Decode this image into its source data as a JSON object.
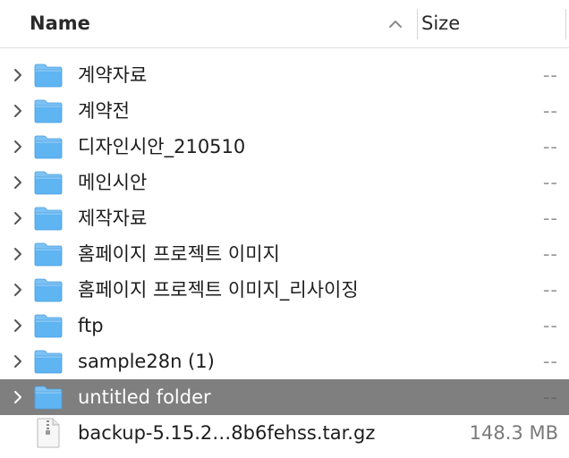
{
  "header": {
    "name_label": "Name",
    "size_label": "Size",
    "sort_icon": "chevron-up-icon"
  },
  "rows": [
    {
      "name": "계약자료",
      "size": "--",
      "kind": "folder"
    },
    {
      "name": "계약전",
      "size": "--",
      "kind": "folder"
    },
    {
      "name": "디자인시안_210510",
      "size": "--",
      "kind": "folder"
    },
    {
      "name": "메인시안",
      "size": "--",
      "kind": "folder"
    },
    {
      "name": "제작자료",
      "size": "--",
      "kind": "folder"
    },
    {
      "name": "홈페이지 프로젝트 이미지",
      "size": "--",
      "kind": "folder"
    },
    {
      "name": "홈페이지 프로젝트 이미지_리사이징",
      "size": "--",
      "kind": "folder"
    },
    {
      "name": "ftp",
      "size": "--",
      "kind": "folder"
    },
    {
      "name": "sample28n (1)",
      "size": "--",
      "kind": "folder"
    },
    {
      "name": "untitled folder",
      "size": "--",
      "kind": "folder",
      "selected": true
    },
    {
      "name": "backup-5.15.2…8b6fehss.tar.gz",
      "size": "148.3 MB",
      "kind": "file"
    }
  ],
  "colors": {
    "selection": "#7f7f7f",
    "folder": "#5fb4f2",
    "folder_tab": "#7cc2f5"
  }
}
